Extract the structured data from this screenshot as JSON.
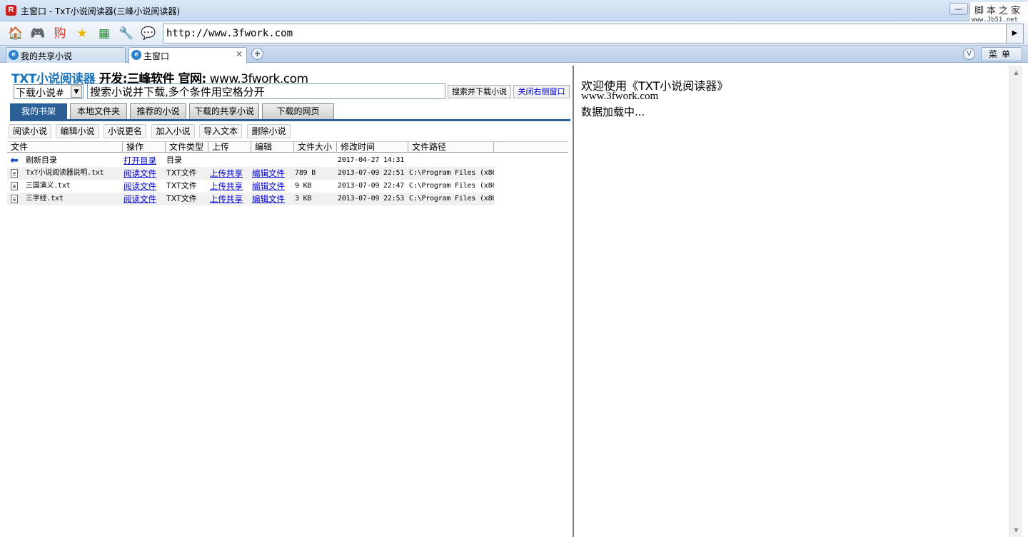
{
  "window": {
    "title": "主窗口 - TxT小说阅读器(三峰小说阅读器)",
    "logo": "R",
    "controls": {
      "minimize": "—",
      "maximize": "□",
      "close": "✕"
    },
    "watermark_line1": "脚本之家",
    "watermark_line2": "www.Jb51.net"
  },
  "toolbar": {
    "icons": [
      {
        "name": "home-icon",
        "glyph": "🏠",
        "color": "#d9372b"
      },
      {
        "name": "game-icon",
        "glyph": "🎮",
        "color": "#3b7fd0"
      },
      {
        "name": "shop-icon",
        "glyph": "购",
        "color": "#d9372b"
      },
      {
        "name": "star-icon",
        "glyph": "★",
        "color": "#f0b400"
      },
      {
        "name": "app-icon",
        "glyph": "▦",
        "color": "#2c8a3a"
      },
      {
        "name": "tools-icon",
        "glyph": "🔧",
        "color": "#c08a2a"
      },
      {
        "name": "chat-icon",
        "glyph": "💬",
        "color": "#e0a020"
      }
    ],
    "address": "http://www.3fwork.com",
    "go_glyph": "▶"
  },
  "browser_tabs": [
    {
      "label": "我的共享小说",
      "active": false
    },
    {
      "label": "主窗口",
      "active": true
    }
  ],
  "newtab_glyph": "+",
  "vip_glyph": "V",
  "menu_label": "菜单",
  "header": {
    "brand": "TXT小说阅读器",
    "developer": " 开发:三峰软件 官网:",
    "website": " www.3fwork.com"
  },
  "search": {
    "type_value": "下载小说#",
    "input_value": "搜索小说并下载,多个条件用空格分开",
    "search_button": "搜索并下载小说",
    "close_right_button": "关闭右侧窗口"
  },
  "panel_tabs": [
    "我的书架",
    "本地文件夹",
    "推荐的小说",
    "下载的共享小说",
    "下载的网页"
  ],
  "actions": [
    "阅读小说",
    "编辑小说",
    "小说更名",
    "加入小说",
    "导入文本",
    "删除小说"
  ],
  "table": {
    "headers": [
      "文件",
      "操作",
      "文件类型",
      "上传",
      "编辑",
      "文件大小",
      "修改时间",
      "文件路径"
    ],
    "rows": [
      {
        "icon": "back-arrow",
        "name": "刷新目录",
        "action": "打开目录",
        "type": "目录",
        "upload": "",
        "edit": "",
        "size": "",
        "time": "2017-04-27 14:31",
        "path": ""
      },
      {
        "icon": "file",
        "name": "TxT小说阅读器说明.txt",
        "action": "阅读文件",
        "type": "TXT文件",
        "upload": "上传共享",
        "edit": "编辑文件",
        "size": "789 B",
        "time": "2013-07-09 22:51",
        "path": "C:\\Program Files (x86"
      },
      {
        "icon": "file",
        "name": "三国演义.txt",
        "action": "阅读文件",
        "type": "TXT文件",
        "upload": "上传共享",
        "edit": "编辑文件",
        "size": "9 KB",
        "time": "2013-07-09 22:47",
        "path": "C:\\Program Files (x86"
      },
      {
        "icon": "file",
        "name": "三字经.txt",
        "action": "阅读文件",
        "type": "TXT文件",
        "upload": "上传共享",
        "edit": "编辑文件",
        "size": "3 KB",
        "time": "2013-07-09 22:53",
        "path": "C:\\Program Files (x86"
      }
    ]
  },
  "right_panel": {
    "welcome": "欢迎使用《TXT小说阅读器》",
    "website": "www.3fwork.com",
    "loading": "数据加载中..."
  }
}
